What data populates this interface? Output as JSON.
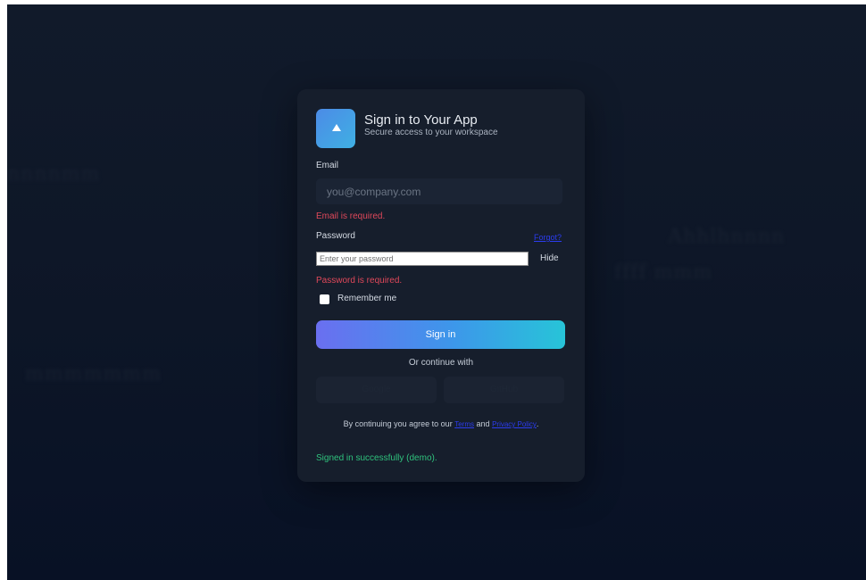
{
  "background": {
    "blur_texts": [
      "nnnnmm",
      "Ahhlhnnnn",
      "mmmmmmm",
      "ffff mmm"
    ]
  },
  "header": {
    "title": "Sign in to Your App",
    "subtitle": "Secure access to your workspace",
    "logo_icon": "triangle-up-icon"
  },
  "email": {
    "label": "Email",
    "placeholder": "you@company.com",
    "value": "",
    "error": "Email is required."
  },
  "password": {
    "label": "Password",
    "forgot_link": "Forgot?",
    "placeholder": "Enter your password",
    "value": "",
    "toggle": "Hide",
    "error": "Password is required."
  },
  "remember": {
    "label": "Remember me",
    "checked": false
  },
  "actions": {
    "signin": "Sign in",
    "divider": "Or continue with",
    "google": "Google",
    "github": "GitHub"
  },
  "terms": {
    "prefix": "By continuing you agree to our",
    "terms_link": "Terms",
    "conjunction": "and",
    "privacy_link": "Privacy Policy",
    "suffix": "."
  },
  "status": {
    "message": "Signed in successfully (demo)."
  },
  "colors": {
    "background": "#0d1627",
    "card": "#161e2c",
    "accent_start": "#6a6ff0",
    "accent_end": "#27c4d8",
    "error": "#e0485a",
    "success": "#2fc27d",
    "link": "#2b3cf0"
  }
}
